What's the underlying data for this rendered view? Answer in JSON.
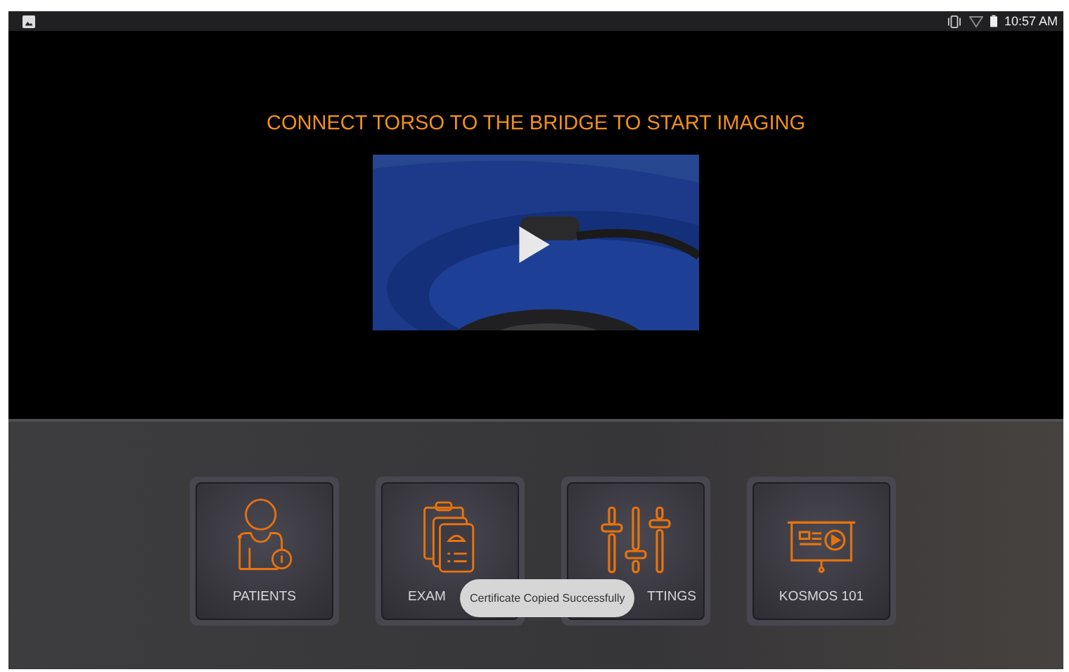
{
  "status_bar": {
    "time": "10:57 AM"
  },
  "prompt": "CONNECT TORSO TO THE BRIDGE TO START IMAGING",
  "tiles": [
    {
      "kind": "patients",
      "label": "PATIENTS"
    },
    {
      "kind": "exams",
      "label": "EXAM"
    },
    {
      "kind": "settings",
      "label": "TTINGS"
    },
    {
      "kind": "learn",
      "label": "KOSMOS 101"
    }
  ],
  "toast": "Certificate Copied Successfully"
}
